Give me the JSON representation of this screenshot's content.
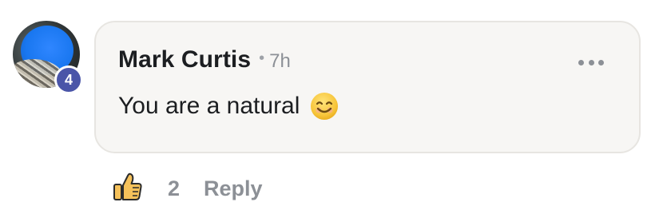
{
  "comment": {
    "author": "Mark Curtis",
    "separator": "•",
    "time": "7h",
    "text": "You are a natural",
    "emoji": "smiling-face-emoji",
    "badge_count": "4",
    "like_count": "2",
    "reply_label": "Reply"
  },
  "icons": {
    "more": "more-horizontal-icon",
    "like": "thumbs-up-icon"
  },
  "colors": {
    "bubble_bg": "#f7f6f4",
    "badge_bg": "#4a55a8",
    "like_icon": "#f5c15a",
    "muted_text": "#8c9096"
  }
}
